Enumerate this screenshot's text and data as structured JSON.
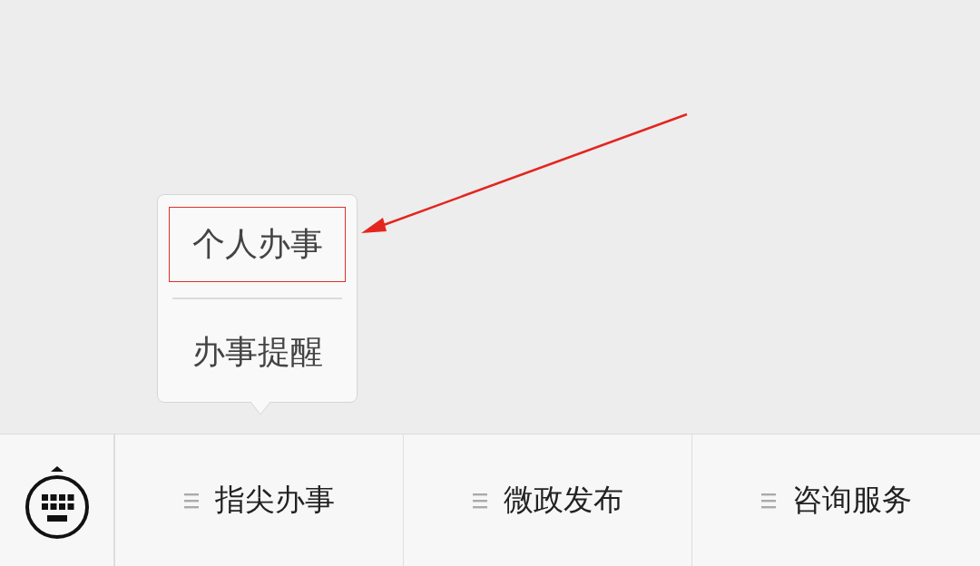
{
  "popup_menu": {
    "items": [
      {
        "label": "个人办事",
        "highlighted": true
      },
      {
        "label": "办事提醒",
        "highlighted": false
      }
    ]
  },
  "annotation": {
    "kind": "arrow"
  },
  "menu_bar": {
    "items": [
      {
        "label": "指尖办事"
      },
      {
        "label": "微政发布"
      },
      {
        "label": "咨询服务"
      }
    ]
  }
}
